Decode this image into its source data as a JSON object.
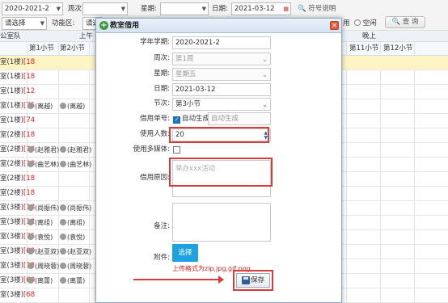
{
  "toolbar": {
    "term_value": "2020-2021-2",
    "week_label": "周次:",
    "weekday_label": "星期:",
    "date_label": "日期:",
    "date_value": "2021-03-12",
    "symbol_help": "符号说明",
    "select_placeholder": "请选择",
    "function_area_label": "功能区:",
    "occupied_label": "用",
    "free_label": "空闲",
    "search_button": "查 询"
  },
  "grid": {
    "header_morning_left": "公室队",
    "header_morning": "上午",
    "header_evening": "晚上",
    "period_headers": [
      "第1小节",
      "第2小节",
      "第11小节",
      "第12小节"
    ],
    "rows": [
      {
        "room": "室(1楼)",
        "cap": "[18"
      },
      {
        "room": "室(1楼)",
        "cap": "[18"
      },
      {
        "room": "室(1楼)",
        "cap": "[12"
      },
      {
        "room": "室(1楼)",
        "cap": "[75",
        "b1": "(离越)",
        "b2": "(离越)"
      },
      {
        "room": "室(1楼)",
        "cap": "[74"
      },
      {
        "room": "室(2楼)",
        "cap": "[18"
      },
      {
        "room": "室(2楼)",
        "cap": "[18",
        "b1": "(赵雅君)",
        "b2": "(赵雅君)"
      },
      {
        "room": "室(2楼)",
        "cap": "[18",
        "b1": "(曲艺林)",
        "b2": "(曲艺林)"
      },
      {
        "room": "室(2楼)",
        "cap": "[18"
      },
      {
        "room": "室(2楼)",
        "cap": "[18"
      },
      {
        "room": "室(3楼)",
        "cap": "[18",
        "b1": "(尚振伟)",
        "b2": "(尚振伟)"
      },
      {
        "room": "室(3楼)",
        "cap": "[12",
        "b1": "(离组)",
        "b2": "(离组)"
      },
      {
        "room": "室(3楼)",
        "cap": "[75",
        "b1": "(袁悦)",
        "b2": "(袁悦)"
      },
      {
        "room": "室(3楼)",
        "cap": "[60",
        "b1": "(赵亚双)",
        "b2": "(赵亚双)"
      },
      {
        "room": "室(3楼)",
        "cap": "[12",
        "b1": "(周晓蓉)",
        "b2": "(周晓蓉)"
      },
      {
        "room": "室(3楼)",
        "cap": "[60",
        "b1": "(离蕾)",
        "b2": "(离蕾)"
      },
      {
        "room": "室(3楼)",
        "cap": "[68"
      }
    ]
  },
  "dialog": {
    "title": "教室借用",
    "fields": {
      "term_label": "学年学期:",
      "term_value": "2020-2021-2",
      "week_label": "周次:",
      "week_value": "第1周",
      "weekday_label": "星期:",
      "weekday_value": "星期五",
      "date_label": "日期:",
      "date_value": "2021-03-12",
      "period_label": "节次:",
      "period_value": "第3小节",
      "number_label": "借用单号:",
      "auto_gen_label": "自动生成",
      "auto_gen_placeholder": "自动生成",
      "people_label": "使用人数:",
      "people_value": "20",
      "media_label": "使用多媒体:",
      "reason_label": "借用原因:",
      "reason_placeholder": "举办xxx活动",
      "remark_label": "备注:",
      "attach_label": "附件:",
      "choose_button": "选择",
      "upload_hint": "上传格式为zip,jpg,gif,png",
      "save_button": "保存"
    }
  },
  "colors": {
    "annotation_red": "#d93a3a",
    "accent_blue": "#1da1e0",
    "highlight_row": "#fff4c4"
  }
}
